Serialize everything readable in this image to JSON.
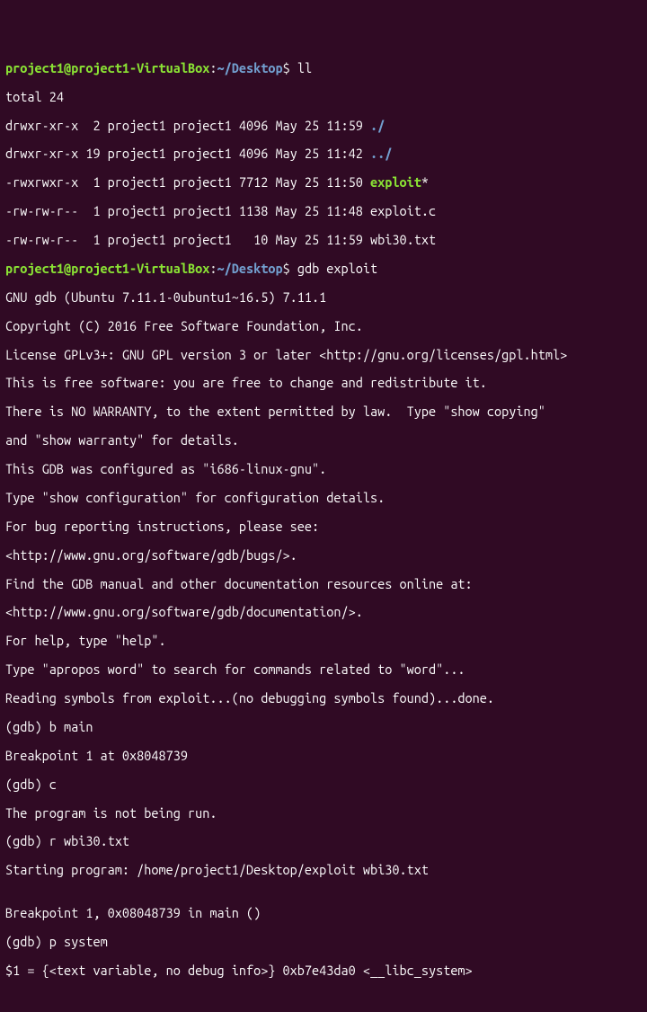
{
  "prompt": {
    "user_host": "project1@project1-VirtualBox",
    "colon": ":",
    "path": "~/Desktop",
    "dollar": "$"
  },
  "cmd1": "ll",
  "ls": {
    "total": "total 24",
    "r1_perm": "drwxr-xr-x  2 project1 project1 4096 May 25 11:59 ",
    "r1_name": "./",
    "r2_perm": "drwxr-xr-x 19 project1 project1 4096 May 25 11:42 ",
    "r2_name": "../",
    "r3_perm": "-rwxrwxr-x  1 project1 project1 7712 May 25 11:50 ",
    "r3_name": "exploit",
    "r3_suffix": "*",
    "r4": "-rw-rw-r--  1 project1 project1 1138 May 25 11:48 exploit.c",
    "r5": "-rw-rw-r--  1 project1 project1   10 May 25 11:59 wbi30.txt"
  },
  "cmd2": "gdb exploit",
  "gdb": {
    "l1": "GNU gdb (Ubuntu 7.11.1-0ubuntu1~16.5) 7.11.1",
    "l2": "Copyright (C) 2016 Free Software Foundation, Inc.",
    "l3": "License GPLv3+: GNU GPL version 3 or later <http://gnu.org/licenses/gpl.html>",
    "l4": "This is free software: you are free to change and redistribute it.",
    "l5": "There is NO WARRANTY, to the extent permitted by law.  Type \"show copying\"",
    "l6": "and \"show warranty\" for details.",
    "l7": "This GDB was configured as \"i686-linux-gnu\".",
    "l8": "Type \"show configuration\" for configuration details.",
    "l9": "For bug reporting instructions, please see:",
    "l10": "<http://www.gnu.org/software/gdb/bugs/>.",
    "l11": "Find the GDB manual and other documentation resources online at:",
    "l12": "<http://www.gnu.org/software/gdb/documentation/>.",
    "l13": "For help, type \"help\".",
    "l14": "Type \"apropos word\" to search for commands related to \"word\"...",
    "l15": "Reading symbols from exploit...(no debugging symbols found)...done."
  },
  "g1_prompt": "(gdb) ",
  "g1_cmd": "b main",
  "g1_out": "Breakpoint 1 at 0x8048739",
  "g2_prompt": "(gdb) ",
  "g2_cmd": "c",
  "g2_out": "The program is not being run.",
  "g3_prompt": "(gdb) ",
  "g3_cmd": "r wbi30.txt",
  "g3_out": "Starting program: /home/project1/Desktop/exploit wbi30.txt",
  "blank": "",
  "g4_out": "Breakpoint 1, 0x08048739 in main ()",
  "g5_prompt": "(gdb) ",
  "g5_cmd": "p system",
  "g5_out": "$1 = {<text variable, no debug info>} 0xb7e43da0 <__libc_system>"
}
